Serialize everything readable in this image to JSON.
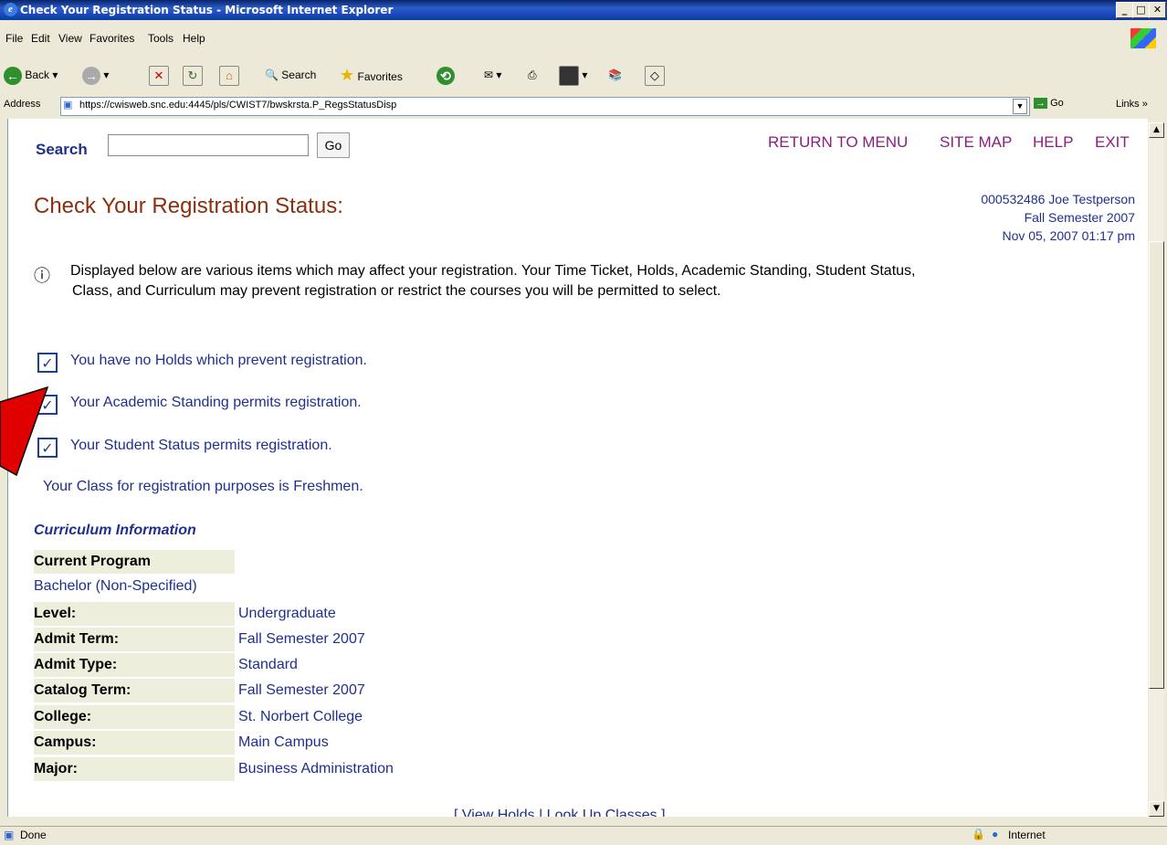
{
  "window": {
    "title": "Check Your Registration Status - Microsoft Internet Explorer"
  },
  "menu": [
    "File",
    "Edit",
    "View",
    "Favorites",
    "Tools",
    "Help"
  ],
  "toolbar": {
    "back": "Back",
    "search": "Search",
    "favorites": "Favorites"
  },
  "address": {
    "label": "Address",
    "url": "https://cwisweb.snc.edu:4445/pls/CWIST7/bwskrsta.P_RegsStatusDisp",
    "go": "Go",
    "links": "Links"
  },
  "page": {
    "search_label": "Search",
    "search_go": "Go",
    "nav": [
      "RETURN TO MENU",
      "SITE MAP",
      "HELP",
      "EXIT"
    ],
    "title": "Check Your Registration Status:",
    "user_line": "000532486 Joe Testperson",
    "term_line": "Fall Semester 2007",
    "date_line": "Nov 05, 2007 01:17 pm",
    "info_line1": "Displayed below are various items which may affect your registration. Your Time Ticket, Holds, Academic Standing, Student Status,",
    "info_line2": "Class, and Curriculum may prevent registration or restrict the courses you will be permitted to select.",
    "checks": [
      "You have no Holds which prevent registration.",
      "Your Academic Standing permits registration.",
      "Your Student Status permits registration."
    ],
    "class_line": "Your Class for registration purposes is Freshmen.",
    "curriculum_heading": "Curriculum Information",
    "current_program_label": "Current Program",
    "program": "Bachelor (Non-Specified)",
    "rows": [
      {
        "label": "Level:",
        "value": "Undergraduate"
      },
      {
        "label": "Admit Term:",
        "value": "Fall Semester 2007"
      },
      {
        "label": "Admit Type:",
        "value": "Standard"
      },
      {
        "label": "Catalog Term:",
        "value": "Fall Semester 2007"
      },
      {
        "label": "College:",
        "value": "St. Norbert College"
      },
      {
        "label": "Campus:",
        "value": "Main Campus"
      },
      {
        "label": "Major:",
        "value": "Business Administration"
      }
    ],
    "bottom_links": "[ View Holds | Look Up Classes ]"
  },
  "status": {
    "text": "Done",
    "zone": "Internet"
  },
  "colors": {
    "title": "#8B2F0F",
    "nav": "#8B1F7F",
    "navy": "#1F2F8F"
  }
}
